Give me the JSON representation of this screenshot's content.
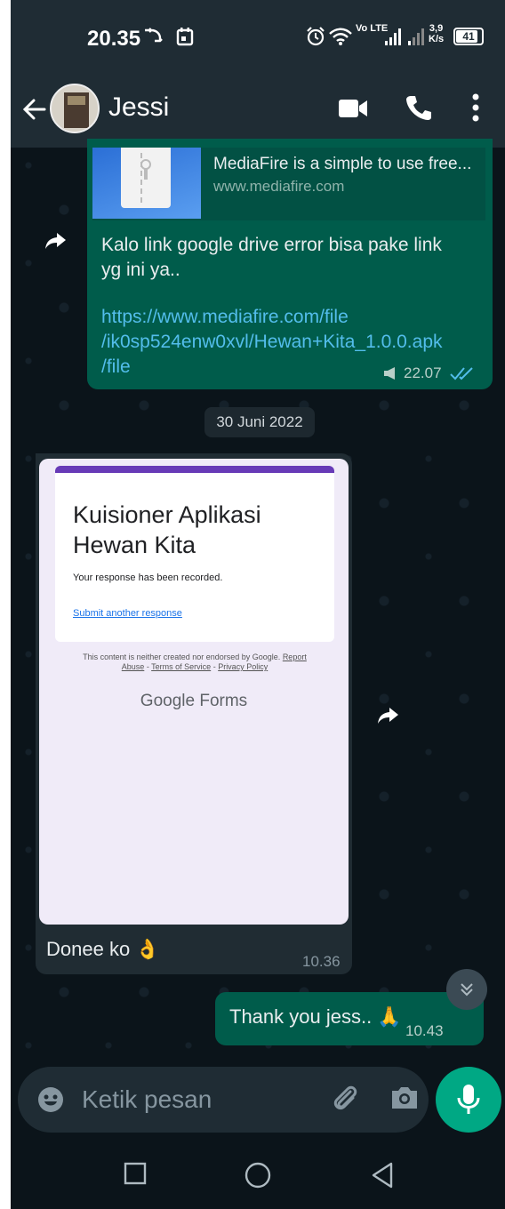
{
  "status_bar": {
    "time": "20.35",
    "network_type": "Vo LTE",
    "speed_value": "3,9",
    "speed_unit": "K/s",
    "battery": "41"
  },
  "header": {
    "contact_name": "Jessi"
  },
  "messages": {
    "link_preview": {
      "title": "MediaFire is a simple to use free...",
      "domain": "www.mediafire.com"
    },
    "outgoing_link": {
      "text_line1": "Kalo link google drive error bisa pake link",
      "text_line2": "yg ini ya..",
      "link_line1": "https://www.mediafire.com/file",
      "link_line2": "/ik0sp524enw0xvl/Hewan+Kita_1.0.0.apk",
      "link_line3": "/file",
      "time": "22.07"
    },
    "date_separator": "30 Juni 2022",
    "incoming_form": {
      "form_title_line1": "Kuisioner Aplikasi",
      "form_title_line2": "Hewan Kita",
      "recorded": "Your response has been recorded.",
      "submit_another": "Submit another response",
      "disclaimer_a": "This content is neither created nor endorsed by Google.",
      "disclaimer_report": "Report",
      "disclaimer_abuse": "Abuse",
      "disclaimer_tos": "Terms of Service",
      "disclaimer_privacy": "Privacy Policy",
      "brand_google": "Google",
      "brand_forms": "Forms",
      "caption": "Donee ko 👌",
      "time": "10.36"
    },
    "outgoing_thanks": {
      "text": "Thank you jess.. 🙏",
      "time": "10.43"
    }
  },
  "composer": {
    "placeholder": "Ketik pesan"
  },
  "colors": {
    "outgoing_bubble": "#005c4b",
    "incoming_bubble": "#202c33",
    "accent": "#00a884",
    "link": "#53bdeb"
  }
}
